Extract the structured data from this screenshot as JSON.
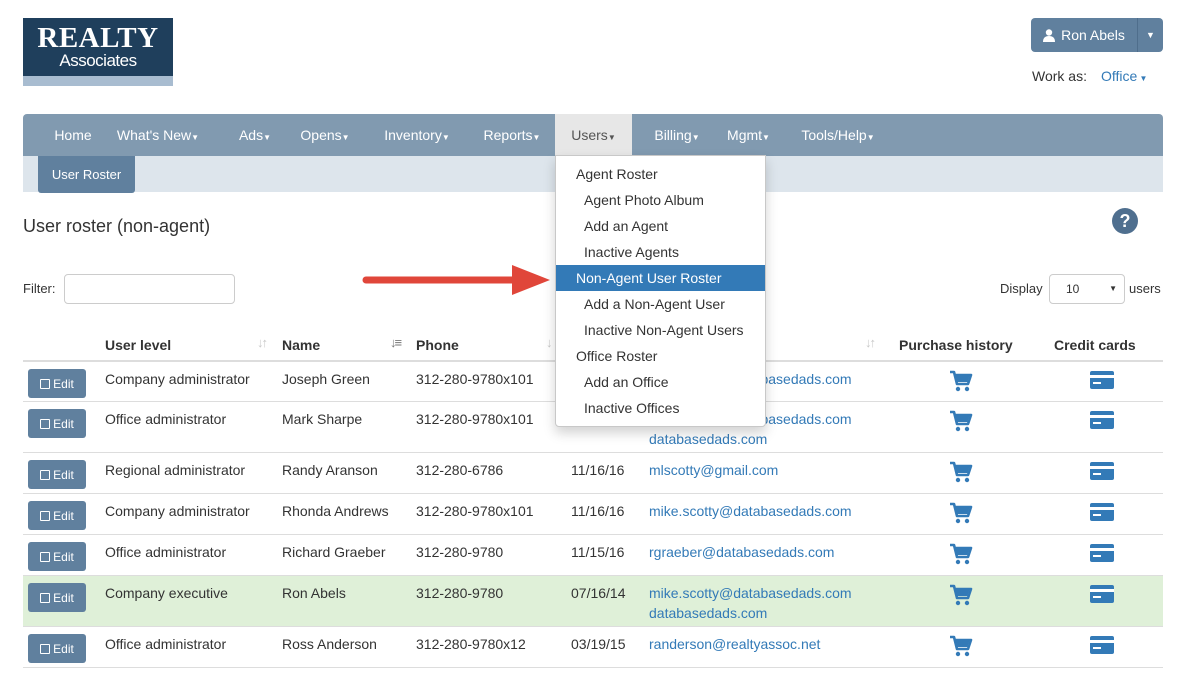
{
  "logo": {
    "line1": "REALTY",
    "line2": "Associates"
  },
  "user": {
    "name": "Ron Abels",
    "work_as_label": "Work as:",
    "work_as_value": "Office"
  },
  "nav": {
    "items": [
      {
        "label": "Home"
      },
      {
        "label": "What's New"
      },
      {
        "label": "Ads"
      },
      {
        "label": "Opens"
      },
      {
        "label": "Inventory"
      },
      {
        "label": "Reports"
      },
      {
        "label": "Users",
        "active": true
      },
      {
        "label": "Billing"
      },
      {
        "label": "Mgmt"
      },
      {
        "label": "Tools/Help"
      }
    ],
    "subnav_label": "User Roster"
  },
  "dropdown": {
    "items": [
      {
        "label": "Agent Roster",
        "level": "top"
      },
      {
        "label": "Agent Photo Album",
        "level": "sub"
      },
      {
        "label": "Add an Agent",
        "level": "sub"
      },
      {
        "label": "Inactive Agents",
        "level": "sub"
      },
      {
        "label": "Non-Agent User Roster",
        "level": "top",
        "active": true
      },
      {
        "label": "Add a Non-Agent User",
        "level": "sub"
      },
      {
        "label": "Inactive Non-Agent Users",
        "level": "sub"
      },
      {
        "label": "Office Roster",
        "level": "top"
      },
      {
        "label": "Add an Office",
        "level": "sub"
      },
      {
        "label": "Inactive Offices",
        "level": "sub"
      }
    ]
  },
  "page": {
    "title": "User roster (non-agent)",
    "filter_label": "Filter:",
    "filter_value": "",
    "display_label": "Display",
    "display_value": "10",
    "users_label": "users"
  },
  "table": {
    "headers": {
      "user_level": "User level",
      "name": "Name",
      "phone": "Phone",
      "purchase_history": "Purchase history",
      "credit_cards": "Credit cards"
    },
    "edit_label": "Edit",
    "rows": [
      {
        "level": "Company administrator",
        "name": "Joseph Green",
        "phone": "312-280-9780x101",
        "date": "",
        "email1": "mike.scotty@databasedads.com",
        "email2": ""
      },
      {
        "level": "Office administrator",
        "name": "Mark Sharpe",
        "phone": "312-280-9780x101",
        "date": "",
        "email1": "mike.scotty@databasedads.com",
        "email2": "databasedads.com"
      },
      {
        "level": "Regional administrator",
        "name": "Randy Aranson",
        "phone": "312-280-6786",
        "date": "11/16/16",
        "email1": "mlscotty@gmail.com",
        "email2": ""
      },
      {
        "level": "Company administrator",
        "name": "Rhonda Andrews",
        "phone": "312-280-9780x101",
        "date": "11/16/16",
        "email1": "mike.scotty@databasedads.com",
        "email2": ""
      },
      {
        "level": "Office administrator",
        "name": "Richard Graeber",
        "phone": "312-280-9780",
        "date": "11/15/16",
        "email1": "rgraeber@databasedads.com",
        "email2": ""
      },
      {
        "level": "Company executive",
        "name": "Ron Abels",
        "phone": "312-280-9780",
        "date": "07/16/14",
        "email1": "mike.scotty@databasedads.com",
        "email2": "databasedads.com",
        "highlight": true
      },
      {
        "level": "Office administrator",
        "name": "Ross Anderson",
        "phone": "312-280-9780x12",
        "date": "03/19/15",
        "email1": "randerson@realtyassoc.net",
        "email2": ""
      }
    ]
  },
  "colors": {
    "nav": "#819ab0",
    "button": "#60809e",
    "link": "#337ab7",
    "highlight_row": "#dff0d8",
    "arrow": "#e0463a"
  }
}
